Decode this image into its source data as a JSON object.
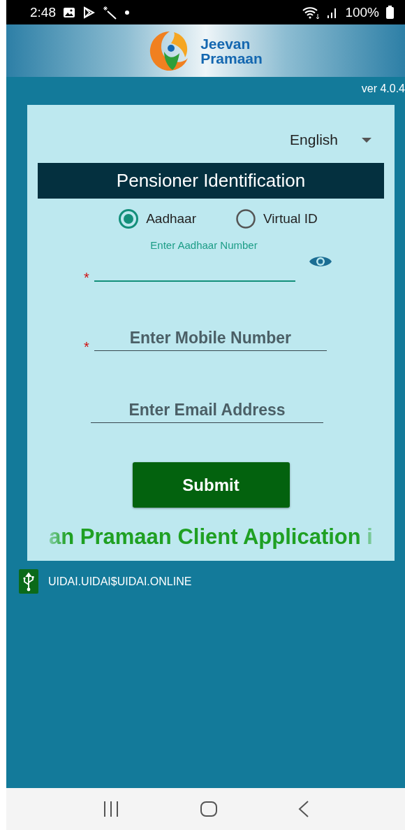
{
  "status_bar": {
    "time": "2:48",
    "battery": "100%"
  },
  "header": {
    "logo_line_1": "Jeevan",
    "logo_line_2": "Pramaan",
    "version": "ver 4.0.4"
  },
  "form": {
    "language": "English",
    "title": "Pensioner Identification",
    "id_types": [
      {
        "label": "Aadhaar",
        "selected": true
      },
      {
        "label": "Virtual ID",
        "selected": false
      }
    ],
    "fields": [
      {
        "kind": "aadhaar",
        "label": "Enter Aadhaar Number",
        "required_mark": "*",
        "focused": true
      },
      {
        "kind": "plain",
        "placeholder": "Enter Mobile Number",
        "required_mark": "*",
        "focused": false
      },
      {
        "kind": "plain",
        "placeholder": "Enter Email Address",
        "focused": false
      }
    ],
    "submit": "Submit",
    "marquee": "an Pramaan Client Application i"
  },
  "notification": {
    "text": "UIDAI.UIDAI$UIDAI.ONLINE"
  }
}
